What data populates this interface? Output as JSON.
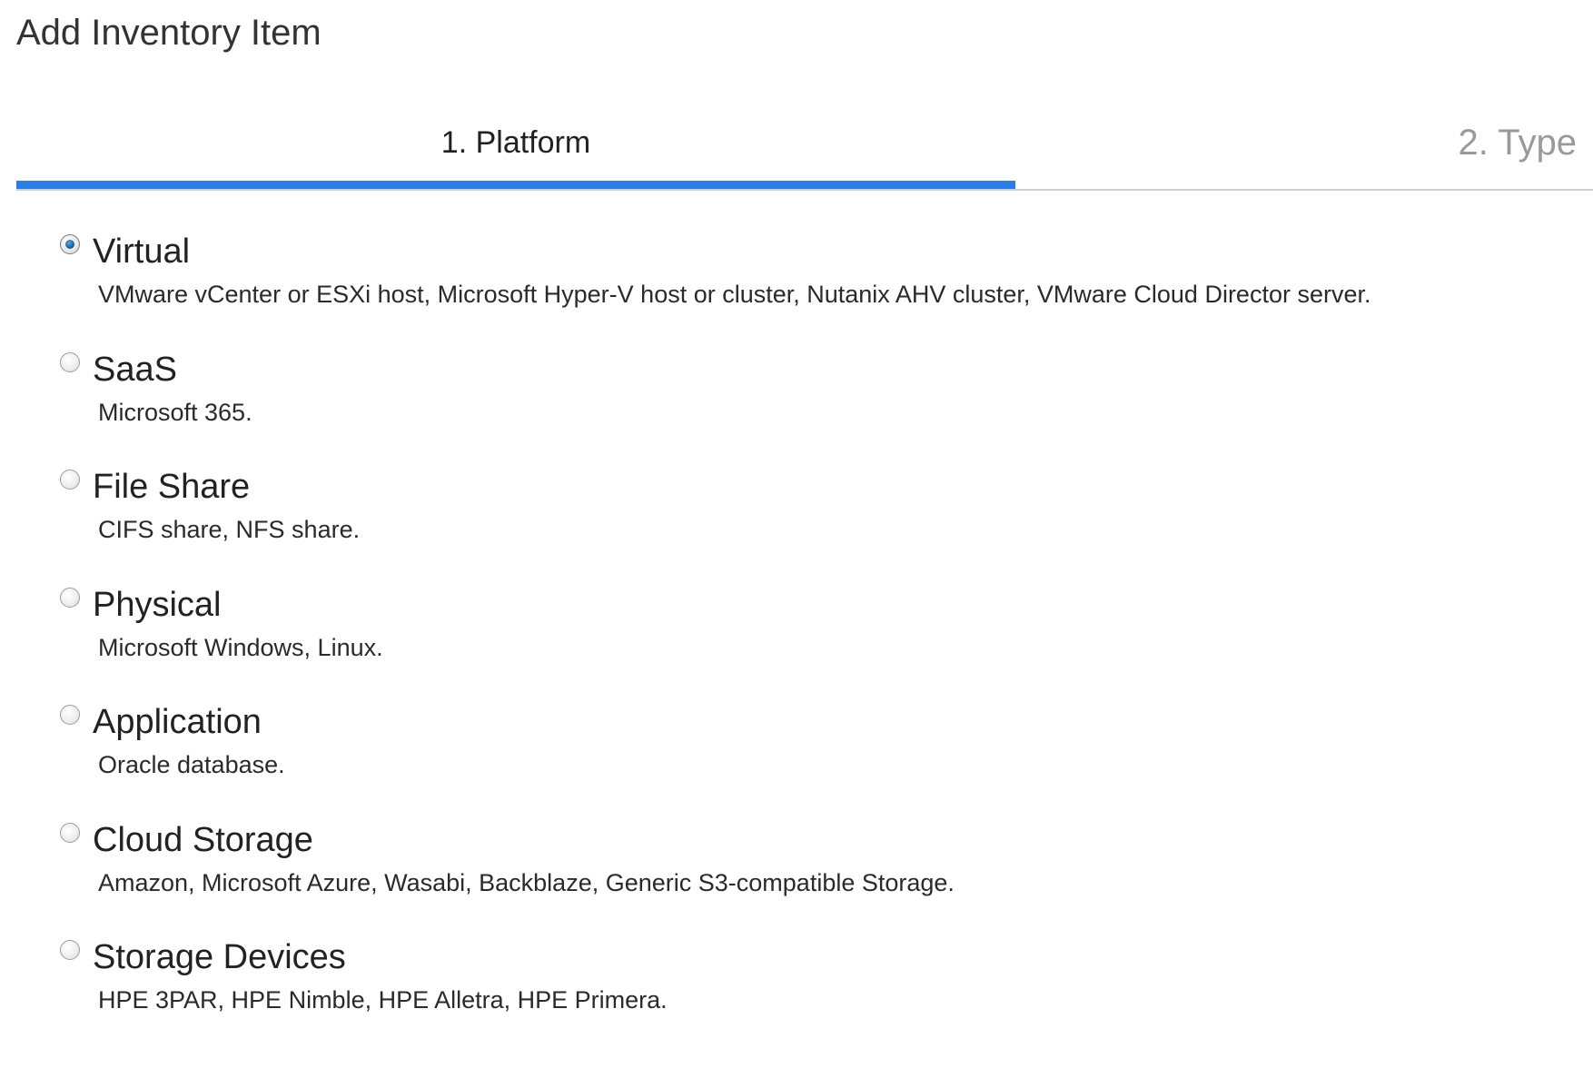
{
  "dialog": {
    "title": "Add Inventory Item"
  },
  "wizard": {
    "steps": [
      {
        "label": "1. Platform",
        "state": "active"
      },
      {
        "label": "2. Type",
        "state": "inactive"
      }
    ],
    "accent_color": "#2b7de9"
  },
  "platform_options": [
    {
      "label": "Virtual",
      "description": "VMware vCenter or ESXi host, Microsoft Hyper-V host or cluster, Nutanix AHV cluster, VMware Cloud Director server.",
      "selected": true
    },
    {
      "label": "SaaS",
      "description": "Microsoft 365.",
      "selected": false
    },
    {
      "label": "File Share",
      "description": "CIFS share, NFS share.",
      "selected": false
    },
    {
      "label": "Physical",
      "description": "Microsoft Windows, Linux.",
      "selected": false
    },
    {
      "label": "Application",
      "description": "Oracle database.",
      "selected": false
    },
    {
      "label": "Cloud Storage",
      "description": "Amazon, Microsoft Azure, Wasabi, Backblaze, Generic S3-compatible Storage.",
      "selected": false
    },
    {
      "label": "Storage Devices",
      "description": "HPE 3PAR, HPE Nimble, HPE Alletra, HPE Primera.",
      "selected": false
    }
  ]
}
